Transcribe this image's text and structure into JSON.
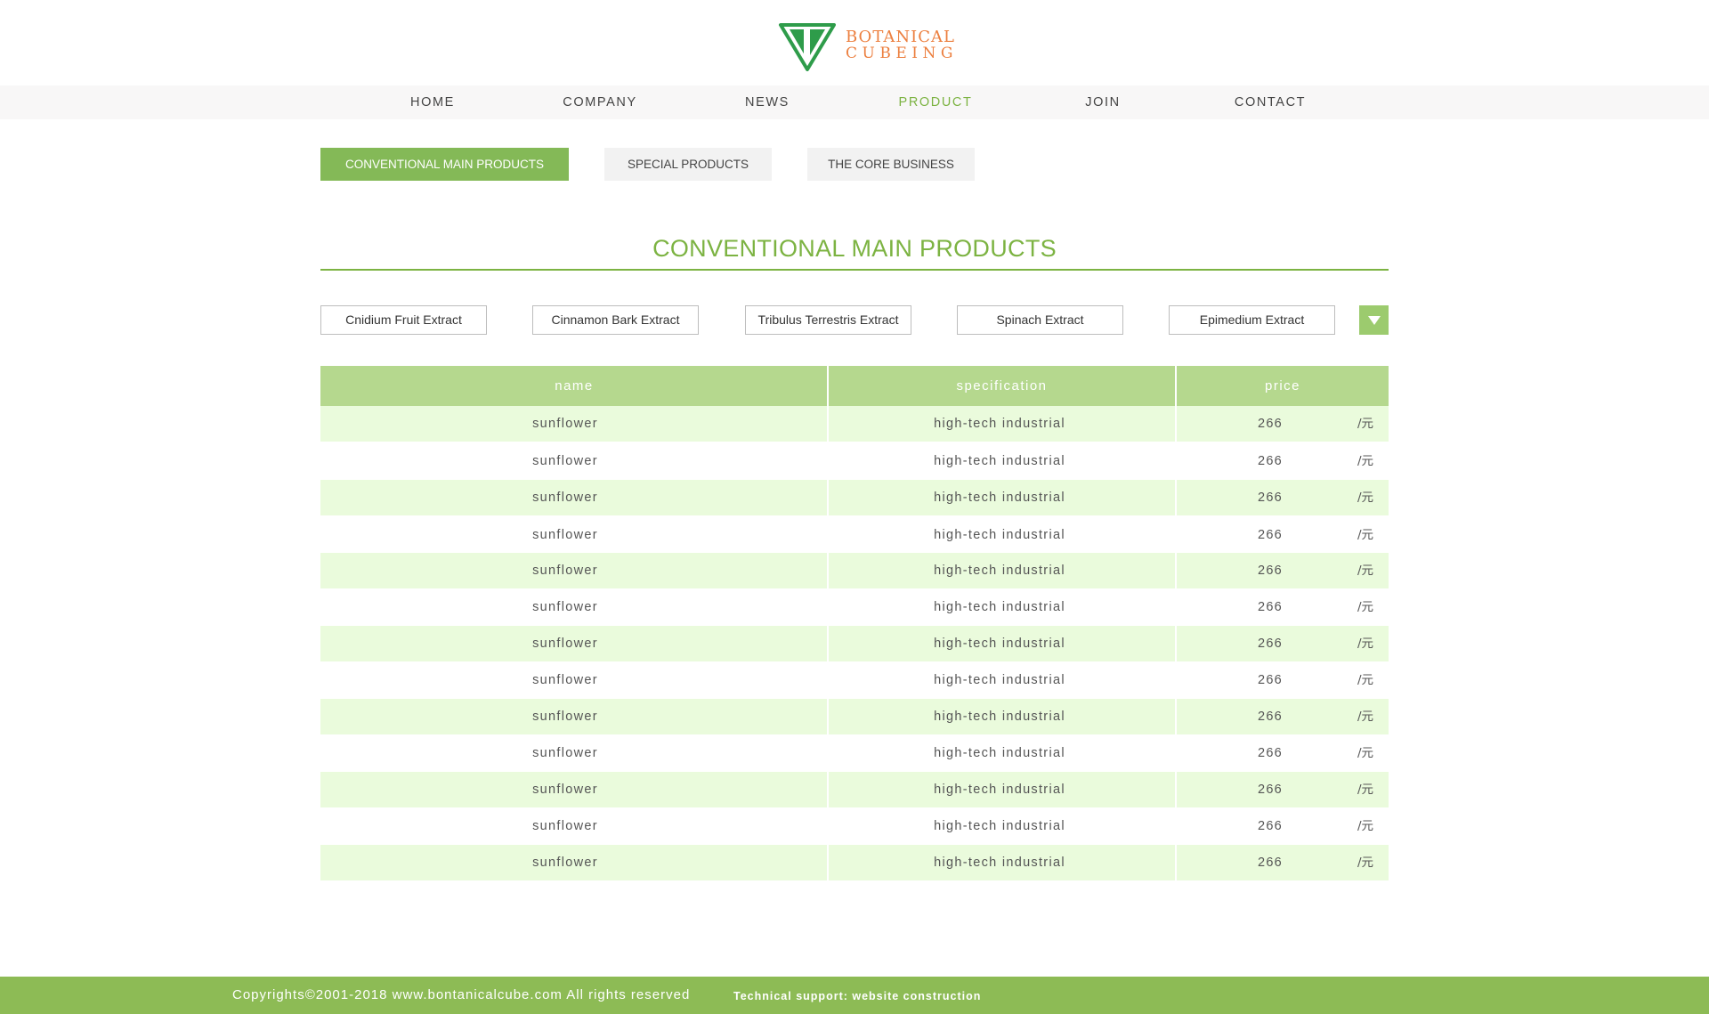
{
  "header": {
    "logo_line1": "BOTANICAL",
    "logo_line2": "CUBEING",
    "logo_color": "#2e9c4a",
    "logo_text_color": "#ec7f3f"
  },
  "nav": {
    "items": [
      "HOME",
      "COMPANY",
      "NEWS",
      "PRODUCT",
      "JOIN",
      "CONTACT"
    ],
    "active": "PRODUCT",
    "active_color": "#7cb342"
  },
  "tabs": {
    "items": [
      "CONVENTIONAL MAIN PRODUCTS",
      "SPECIAL PRODUCTS",
      "THE CORE BUSINESS"
    ],
    "active": "CONVENTIONAL MAIN PRODUCTS"
  },
  "section": {
    "title": "CONVENTIONAL MAIN PRODUCTS"
  },
  "filters": {
    "items": [
      "Cnidium Fruit Extract",
      "Cinnamon Bark Extract",
      "Tribulus Terrestris Extract",
      "Spinach Extract",
      "Epimedium Extract"
    ],
    "dropdown_icon": "triangle-down-icon"
  },
  "table": {
    "headers": [
      "name",
      "specification",
      "price"
    ],
    "rows": [
      {
        "name": "sunflower",
        "specification": "high-tech industrial",
        "price": "266",
        "unit": "/元"
      },
      {
        "name": "sunflower",
        "specification": "high-tech industrial",
        "price": "266",
        "unit": "/元"
      },
      {
        "name": "sunflower",
        "specification": "high-tech industrial",
        "price": "266",
        "unit": "/元"
      },
      {
        "name": "sunflower",
        "specification": "high-tech industrial",
        "price": "266",
        "unit": "/元"
      },
      {
        "name": "sunflower",
        "specification": "high-tech industrial",
        "price": "266",
        "unit": "/元"
      },
      {
        "name": "sunflower",
        "specification": "high-tech industrial",
        "price": "266",
        "unit": "/元"
      },
      {
        "name": "sunflower",
        "specification": "high-tech industrial",
        "price": "266",
        "unit": "/元"
      },
      {
        "name": "sunflower",
        "specification": "high-tech industrial",
        "price": "266",
        "unit": "/元"
      },
      {
        "name": "sunflower",
        "specification": "high-tech industrial",
        "price": "266",
        "unit": "/元"
      },
      {
        "name": "sunflower",
        "specification": "high-tech industrial",
        "price": "266",
        "unit": "/元"
      },
      {
        "name": "sunflower",
        "specification": "high-tech industrial",
        "price": "266",
        "unit": "/元"
      },
      {
        "name": "sunflower",
        "specification": "high-tech industrial",
        "price": "266",
        "unit": "/元"
      },
      {
        "name": "sunflower",
        "specification": "high-tech industrial",
        "price": "266",
        "unit": "/元"
      }
    ]
  },
  "footer": {
    "copyright": "Copyrights©2001-2018 www.bontanicalcube.com All rights reserved",
    "support": "Technical support: website construction",
    "color": "#8dbb55"
  }
}
